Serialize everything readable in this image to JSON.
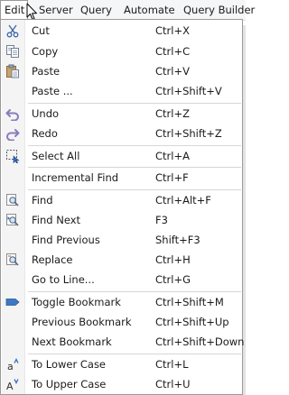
{
  "menubar": {
    "items": [
      "Edit",
      "Server",
      "Query",
      "Automate",
      "Query Builder"
    ]
  },
  "menu": {
    "items": [
      {
        "label": "Cut",
        "shortcut": "Ctrl+X",
        "icon": "cut-icon"
      },
      {
        "label": "Copy",
        "shortcut": "Ctrl+C",
        "icon": "copy-icon"
      },
      {
        "label": "Paste",
        "shortcut": "Ctrl+V",
        "icon": "paste-icon"
      },
      {
        "label": "Paste ...",
        "shortcut": "Ctrl+Shift+V"
      },
      {
        "label": "Undo",
        "shortcut": "Ctrl+Z",
        "icon": "undo-icon"
      },
      {
        "label": "Redo",
        "shortcut": "Ctrl+Shift+Z",
        "icon": "redo-icon"
      },
      {
        "label": "Select All",
        "shortcut": "Ctrl+A",
        "icon": "select-all-icon"
      },
      {
        "label": "Incremental Find",
        "shortcut": "Ctrl+F"
      },
      {
        "label": "Find",
        "shortcut": "Ctrl+Alt+F",
        "icon": "find-icon"
      },
      {
        "label": "Find Next",
        "shortcut": "F3",
        "icon": "find-next-icon"
      },
      {
        "label": "Find Previous",
        "shortcut": "Shift+F3"
      },
      {
        "label": "Replace",
        "shortcut": "Ctrl+H",
        "icon": "replace-icon"
      },
      {
        "label": "Go to Line...",
        "shortcut": "Ctrl+G"
      },
      {
        "label": "Toggle Bookmark",
        "shortcut": "Ctrl+Shift+M",
        "icon": "bookmark-icon"
      },
      {
        "label": "Previous Bookmark",
        "shortcut": "Ctrl+Shift+Up"
      },
      {
        "label": "Next Bookmark",
        "shortcut": "Ctrl+Shift+Down"
      },
      {
        "label": "To Lower Case",
        "shortcut": "Ctrl+L",
        "icon": "lowercase-icon"
      },
      {
        "label": "To Upper Case",
        "shortcut": "Ctrl+U",
        "icon": "uppercase-icon"
      }
    ]
  },
  "colors": {
    "icon_purple": "#8a7bbf",
    "bookmark_blue": "#3d78c2",
    "cut_blue": "#3a66a8",
    "separator": "#d7d7d7"
  }
}
